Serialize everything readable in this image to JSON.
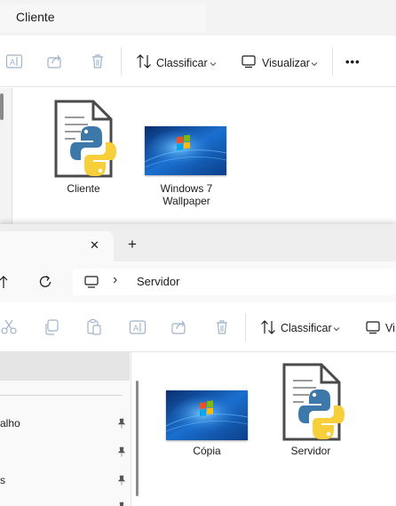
{
  "window1": {
    "title": "Cliente",
    "toolbar": {
      "sort_label": "Classificar",
      "view_label": "Visualizar",
      "more_label": "•••"
    },
    "files": [
      {
        "name": "Cliente",
        "icon": "python-file-icon"
      },
      {
        "name_line1": "Windows 7",
        "name_line2": "Wallpaper",
        "icon": "wallpaper-thumbnail"
      }
    ]
  },
  "window2": {
    "tab_title": "",
    "close_glyph": "✕",
    "new_tab_glyph": "+",
    "breadcrumb": {
      "separator": "›",
      "folder": "Servidor"
    },
    "toolbar": {
      "sort_label": "Classificar",
      "view_label_partial": "Vi"
    },
    "nav_items": [
      {
        "label": "alho",
        "pinned": true
      },
      {
        "label": "",
        "pinned": true
      },
      {
        "label": "s",
        "pinned": true
      }
    ],
    "files": [
      {
        "name": "Cópia",
        "icon": "wallpaper-thumbnail"
      },
      {
        "name": "Servidor",
        "icon": "python-file-icon"
      }
    ]
  },
  "colors": {
    "python_blue": "#3d78aa",
    "python_yellow": "#f7cf3b",
    "accent_blue": "#1565c0",
    "wallpaper_dark": "#0b3f8a",
    "wallpaper_light": "#3aa0f0"
  }
}
